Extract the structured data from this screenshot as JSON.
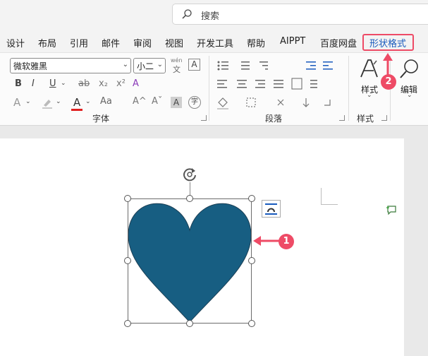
{
  "search": {
    "label": "搜索"
  },
  "tabs": [
    {
      "label": "设计"
    },
    {
      "label": "布局"
    },
    {
      "label": "引用"
    },
    {
      "label": "邮件"
    },
    {
      "label": "审阅"
    },
    {
      "label": "视图"
    },
    {
      "label": "开发工具"
    },
    {
      "label": "帮助"
    },
    {
      "label": "AIPPT"
    },
    {
      "label": "百度网盘"
    },
    {
      "label": "形状格式",
      "active": true
    }
  ],
  "font": {
    "name": "微软雅黑",
    "size": "小二",
    "wen_glyph": "wén",
    "wen_char": "文",
    "a_box": "A",
    "bold": "B",
    "italic": "I",
    "underline": "U",
    "strike": "ab",
    "subscript": "x₂",
    "superscript": "x²",
    "clear_format": "A",
    "text_effect": "A",
    "highlight": "ℓ",
    "font_color": "A",
    "aa_upper": "Aa",
    "grow": "A^",
    "shrink": "Aˇ",
    "char_shading": "A",
    "enclosed": "字",
    "group_label": "字体"
  },
  "paragraph": {
    "group_label": "段落"
  },
  "styles": {
    "label": "样式",
    "group_label": "样式"
  },
  "editing": {
    "label": "编辑"
  },
  "callouts": {
    "one": "1",
    "two": "2"
  },
  "colors": {
    "heart": "#175e82",
    "callout": "#ee4b66",
    "accent": "#185abd"
  }
}
